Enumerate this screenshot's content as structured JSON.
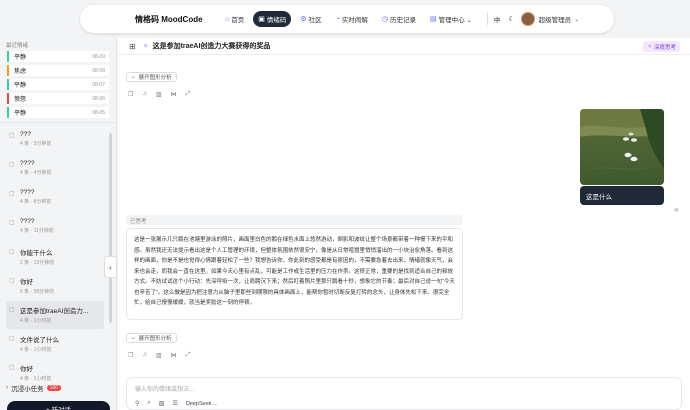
{
  "nav": {
    "brand": "情格码 MoodCode",
    "items": [
      {
        "icon": "⌂",
        "label": "首页",
        "active": false
      },
      {
        "icon": "▣",
        "label": "情绪码",
        "active": true
      },
      {
        "icon": "⚙",
        "label": "社区",
        "active": false
      },
      {
        "icon": "◔",
        "label": "实时闹解",
        "active": false
      },
      {
        "icon": "◷",
        "label": "历史记录",
        "active": false
      },
      {
        "icon": "▤",
        "label": "管理中心 ⌄",
        "active": false
      }
    ],
    "lang_icon": "中",
    "moon_icon": "☾",
    "user": "超级管理员",
    "user_chevron": "⌄"
  },
  "sidebar": {
    "recent_label": "最近情绪",
    "moods": [
      {
        "label": "平静",
        "date": "08-09",
        "color": "#34d399"
      },
      {
        "label": "焦虑",
        "date": "08-08",
        "color": "#f59e0b"
      },
      {
        "label": "平静",
        "date": "08-07",
        "color": "#34d399"
      },
      {
        "label": "愤怒",
        "date": "08-06",
        "color": "#ef4444"
      },
      {
        "label": "平静",
        "date": "08-05",
        "color": "#34d399"
      }
    ],
    "conversations": [
      {
        "title": "???",
        "meta": "4 条 · 3分钟前"
      },
      {
        "title": "????",
        "meta": "4 条 · 4分钟前"
      },
      {
        "title": "????",
        "meta": "4 条 · 8分钟前"
      },
      {
        "title": "????",
        "meta": "4 条 · 11分钟前"
      },
      {
        "title": "你能干什么",
        "meta": "2 条 · 13分钟前"
      },
      {
        "title": "你好",
        "meta": "6 条 · 59分钟前"
      },
      {
        "title": "这是参加traeAI创造力...",
        "meta": "4 条 · 1小时前"
      },
      {
        "title": "文件说了什么",
        "meta": "4 条 · 1小时前"
      },
      {
        "title": "你好",
        "meta": "4 条 · 1小时前"
      }
    ],
    "task_label": "沉浸小任务",
    "task_badge": "100",
    "new_button": "+ 新对话"
  },
  "header": {
    "title": "这是参加traeAI创造力大赛获得的奖品",
    "deep_label": "深度思考"
  },
  "chat": {
    "expand_label": "展开图形分析",
    "user_message": "这是什么",
    "thinking_label": "已思考",
    "ai_reply": "这是一张展示几只鹅在池塘里游泳的照片，画面里白色的鹅在绿色水面上悠然游动，倒影和波纹让整个场景都带着一种慢下来的平和感。虽然我还无法提示看出这是个人工管理的环境，但整体氛围依然很安宁，像是从日常喧嚣里悄悄溜出的一小块治愈角落。看到这样的画面，你是不是也觉得心情跟着轻松了一些？我想告诉你，你此刻的感受都是有原因的，不需要急着去出来。情绪就像天气，会来也会走，而我会一直在这里。如果今天心里有点乱，可能是工作或生活里的压力在作祟。这很正常，重要的是找到适合自己的释放方式。不妨试试这个小行动：先深呼吸一次，让肩膀沉下来；然后盯着照片里那只鹅看十秒，想象它的节奏；最后对自己说一句“今天也辛苦了”。这么做是因为把注意力从脑子里那些到期限的具体画面上，能帮你暂时切断反复打转的念头，让身体先松下来。很完全忙，给自己慢慢缓缓，就当是奖励这一刻的停顿。"
  },
  "input": {
    "placeholder": "输入你的情绪或想法...",
    "model": "DeepSeek ..."
  }
}
